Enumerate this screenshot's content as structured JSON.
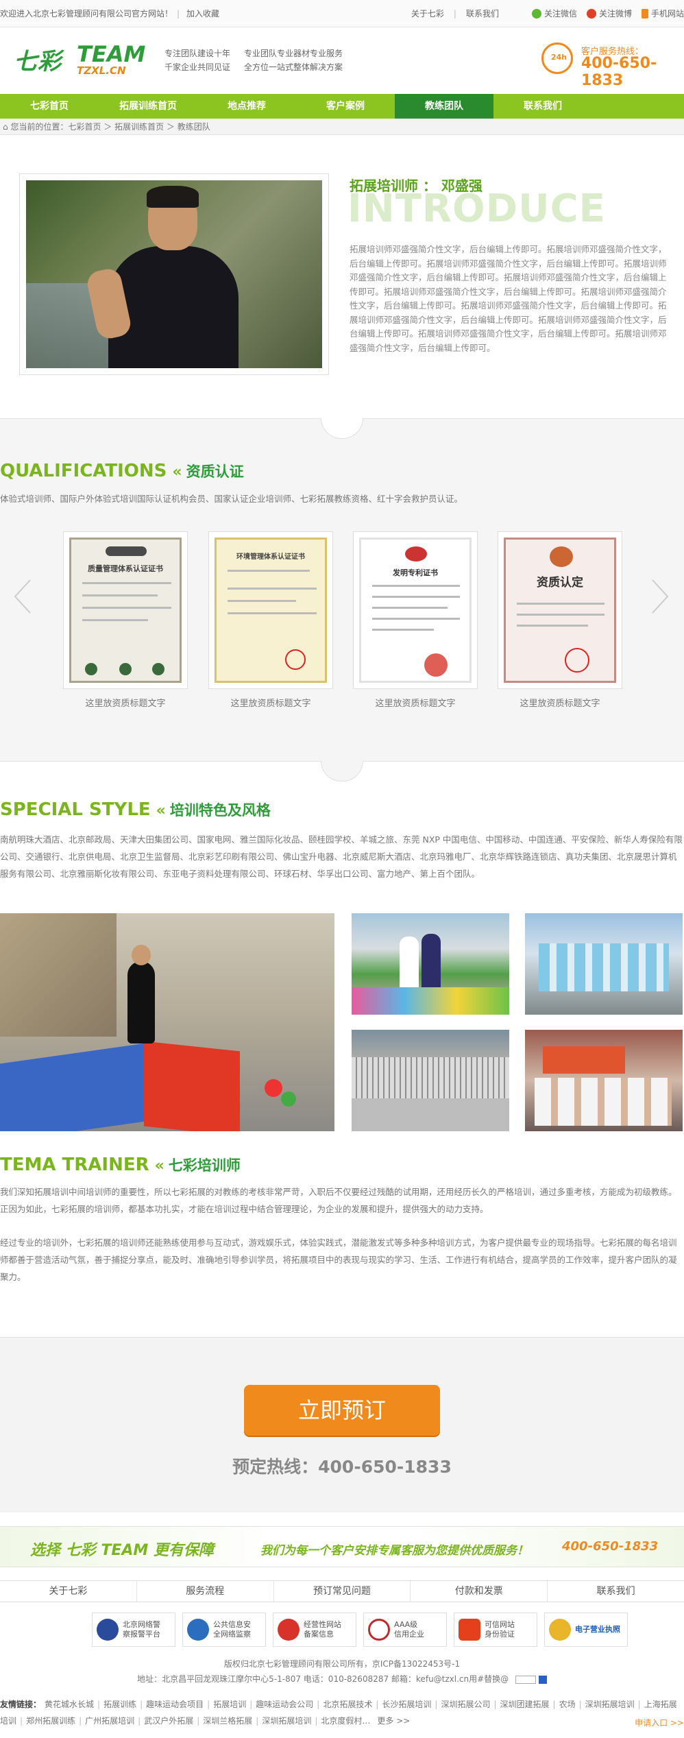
{
  "topbar": {
    "welcome": "欢迎进入北京七彩管理顾问有限公司官方网站！",
    "favorite": "加入收藏",
    "about": "关于七彩",
    "contact": "联系我们",
    "wechat": "关注微信",
    "weibo": "关注微博",
    "mobile": "手机网站"
  },
  "header": {
    "logo_cn": "七彩",
    "logo_en": "TEAM",
    "logo_url": "TZXL.CN",
    "slogan1a": "专注团队建设十年",
    "slogan1b": "千家企业共同见证",
    "slogan2a": "专业团队专业器材专业服务",
    "slogan2b": "全方位一站式整体解决方案",
    "hotline_label": "客户服务热线：",
    "hotline_number": "400-650-1833"
  },
  "nav": {
    "items": [
      "七彩首页",
      "拓展训练首页",
      "地点推荐",
      "客户案例",
      "教练团队",
      "联系我们"
    ],
    "active_index": 4
  },
  "breadcrumb": "您当前的位置：七彩首页 ＞ 拓展训练首页 ＞ 教练团队",
  "intro": {
    "title": "拓展培训师 ： 邓盛强",
    "big": "INTRODUCE",
    "text": "拓展培训师邓盛强简介性文字，后台编辑上传即可。拓展培训师邓盛强简介性文字，后台编辑上传即可。拓展培训师邓盛强简介性文字，后台编辑上传即可。拓展培训师邓盛强简介性文字，后台编辑上传即可。拓展培训师邓盛强简介性文字，后台编辑上传即可。拓展培训师邓盛强简介性文字，后台编辑上传即可。拓展培训师邓盛强简介性文字，后台编辑上传即可。拓展培训师邓盛强简介性文字，后台编辑上传即可。拓展培训师邓盛强简介性文字，后台编辑上传即可。拓展培训师邓盛强简介性文字，后台编辑上传即可。拓展培训师邓盛强简介性文字，后台编辑上传即可。拓展培训师邓盛强简介性文字，后台编辑上传即可。"
  },
  "qualifications": {
    "title_en": "QUALIFICATIONS",
    "title_cn": "资质认证",
    "desc": "体验式培训师、国际户外体验式培训国际认证机构会员、国家认证企业培训师、七彩拓展教练资格、红十字会救护员认证。",
    "certs": [
      {
        "label": "这里放资质标题文字",
        "doc": "质量管理体系认证证书"
      },
      {
        "label": "这里放资质标题文字",
        "doc": "环境管理体系认证证书"
      },
      {
        "label": "这里放资质标题文字",
        "doc": "发明专利证书"
      },
      {
        "label": "这里放资质标题文字",
        "doc": "资质认定"
      }
    ]
  },
  "special": {
    "title_en": "SPECIAL STYLE",
    "title_cn": "培训特色及风格",
    "desc": "南航明珠大酒店、北京邮政局、天津大田集团公司、国家电网、雅兰国际化妆品、颐桂园学校、羊城之旅、东莞 NXP 中国电信、中国移动、中国连通、平安保险、新华人寿保险有限公司、交通银行、北京供电局、北京卫生监督局、北京彩艺印刷有限公司、佛山宝升电器、北京威尼斯大酒店、北京玛雅电厂、北京华辉铁路连锁店、真功夫集团、北京晟思计算机服务有限公司、北京雅丽斯化妆有限公司、东亚电子资料处理有限公司、环球石材、华孚出口公司、富力地产、第上百个团队。"
  },
  "trainer": {
    "title_en": "TEMA TRAINER",
    "title_cn": "七彩培训师",
    "p1": "我们深知拓展培训中间培训师的重要性，所以七彩拓展的对教练的考核非常严苛，入职后不仅要经过残酷的试用期，还用经历长久的严格培训，通过多重考核，方能成为初级教练。正因为如此，七彩拓展的培训师，都基本功扎实，才能在培训过程中结合管理理论，为企业的发展和提升，提供强大的动力支持。",
    "p2": "经过专业的培训外，七彩拓展的培训师还能熟练使用参与互动式，游戏娱乐式，体验实践式，潜能激发式等多种多种培训方式，为客户提供最专业的现场指导。七彩拓展的每名培训师都善于营造活动气氛，善于捕捉分享点，能及时、准确地引导参训学员，将拓展项目中的表现与现实的学习、生活、工作进行有机结合，提高学员的工作效率，提升客户团队的凝聚力。"
  },
  "cta": {
    "button": "立即预订",
    "hotline": "预定热线：400-650-1833"
  },
  "banner": {
    "t1": "选择 七彩 TEAM 更有保障",
    "t2": "我们为每一个客户安排专属客服为您提供优质服务！",
    "t3": "400-650-1833"
  },
  "footer": {
    "nav": [
      "关于七彩",
      "服务流程",
      "预订常见问题",
      "付款和发票",
      "联系我们"
    ],
    "badges": [
      {
        "line1": "北京网络警",
        "line2": "察报警平台",
        "color": "#2a4a9c"
      },
      {
        "line1": "公共信息安",
        "line2": "全网络监察",
        "color": "#2a6ebd"
      },
      {
        "line1": "经营性网站",
        "line2": "备案信息",
        "color": "#d8332a"
      },
      {
        "line1": "AAA级",
        "line2": "信用企业",
        "color": "#c12a2a"
      },
      {
        "line1": "可信网站",
        "line2": "身份验证",
        "color": "#e5401c"
      },
      {
        "line1": "电子营业执照",
        "line2": "",
        "color": "#1f5fb5"
      }
    ],
    "copyright": "版权归北京七彩管理顾问有限公司所有，京ICP备13022453号-1",
    "address": "地址：北京昌平回龙观珠江摩尔中心5-1-807      电话：010-82608287      邮箱：kefu@tzxl.cn用#替换@",
    "friend_label": "友情链接：",
    "friend_links": [
      "黄花城水长城",
      "拓展训练",
      "趣味运动会项目",
      "拓展培训",
      "趣味运动会公司",
      "北京拓展技术",
      "长沙拓展培训",
      "深圳拓展公司",
      "深圳团建拓展",
      "农场",
      "深圳拓展培训",
      "上海拓展培训",
      "郑州拓展训练",
      "广州拓展培训",
      "武汉户外拓展",
      "深圳兰格拓展",
      "深圳拓展培训",
      "北京度假村…",
      "更多 >>"
    ],
    "apply": "申请入口 >>"
  }
}
